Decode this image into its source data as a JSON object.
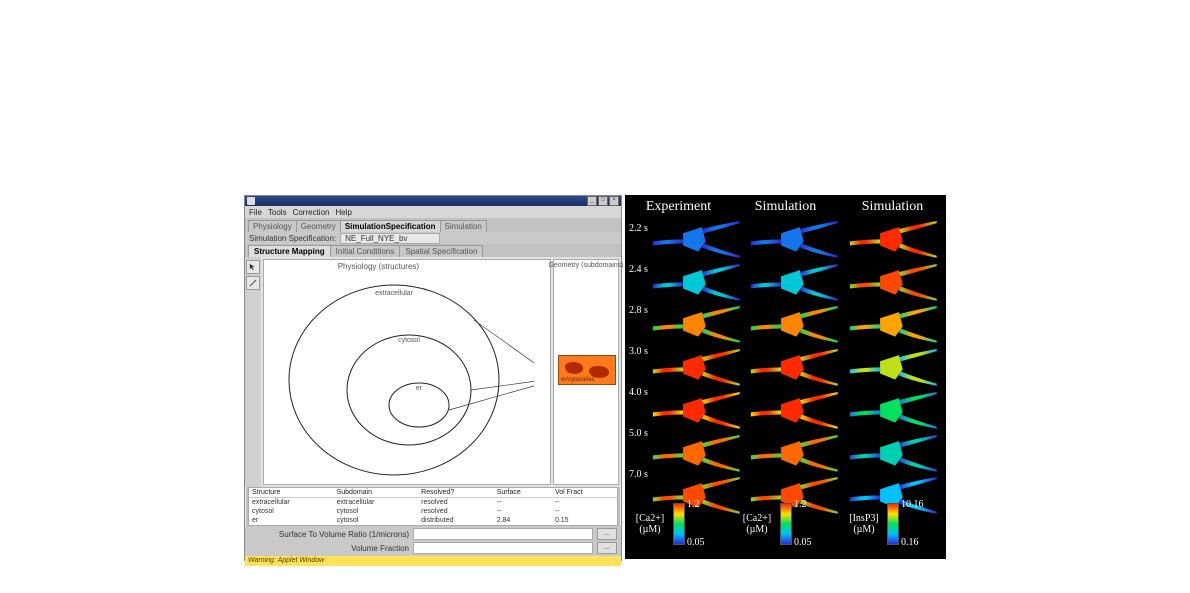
{
  "app": {
    "menu": [
      "File",
      "Tools",
      "Correction",
      "Help"
    ],
    "tabs1": [
      "Physiology",
      "Geometry",
      "SimulationSpecification",
      "Simulation"
    ],
    "tabs1_active_index": 2,
    "sim_spec_label": "Simulation Specification:",
    "sim_spec_value": "NE_Full_NYE_bv",
    "tabs2": [
      "Structure Mapping",
      "Initial Conditions",
      "Spatial Specification"
    ],
    "tabs2_active_index": 0,
    "struct_panel_header": "Physiology (structures)",
    "struct_labels": {
      "outer": "extracellular",
      "mid": "cytosol",
      "inner": "er"
    },
    "geom_panel_header": "Geometry (subdomains)",
    "geom_thumb_label": "er/cytosol/ec",
    "table": {
      "headers": [
        "Structure",
        "Subdomain",
        "Resolved?",
        "Surface",
        "Vol Fract"
      ],
      "rows": [
        [
          "extracellular",
          "extracellular",
          "resolved",
          "--",
          "--"
        ],
        [
          "cytosol",
          "cytosol",
          "resolved",
          "--",
          "--"
        ],
        [
          "er",
          "cytosol",
          "distributed",
          "2.84",
          "0.15"
        ]
      ]
    },
    "field1_label": "Surface To Volume Ratio (1/microns)",
    "field2_label": "Volume Fraction",
    "browse_btn": "...",
    "status": "Warning: Applet Window"
  },
  "figure": {
    "columns": [
      "Experiment",
      "Simulation",
      "Simulation"
    ],
    "times": [
      "2.2 s",
      "2.4 s",
      "2.8 s",
      "3.0 s",
      "4.0 s",
      "5.0 s",
      "7.0 s"
    ],
    "colorbars": [
      {
        "label": "[Ca2+]\n(µM)",
        "min": "0.05",
        "max": "1.2"
      },
      {
        "label": "[Ca2+]\n(µM)",
        "min": "0.05",
        "max": "1.2"
      },
      {
        "label": "[InsP3]\n(µM)",
        "min": "0.16",
        "max": "10.16"
      }
    ]
  }
}
